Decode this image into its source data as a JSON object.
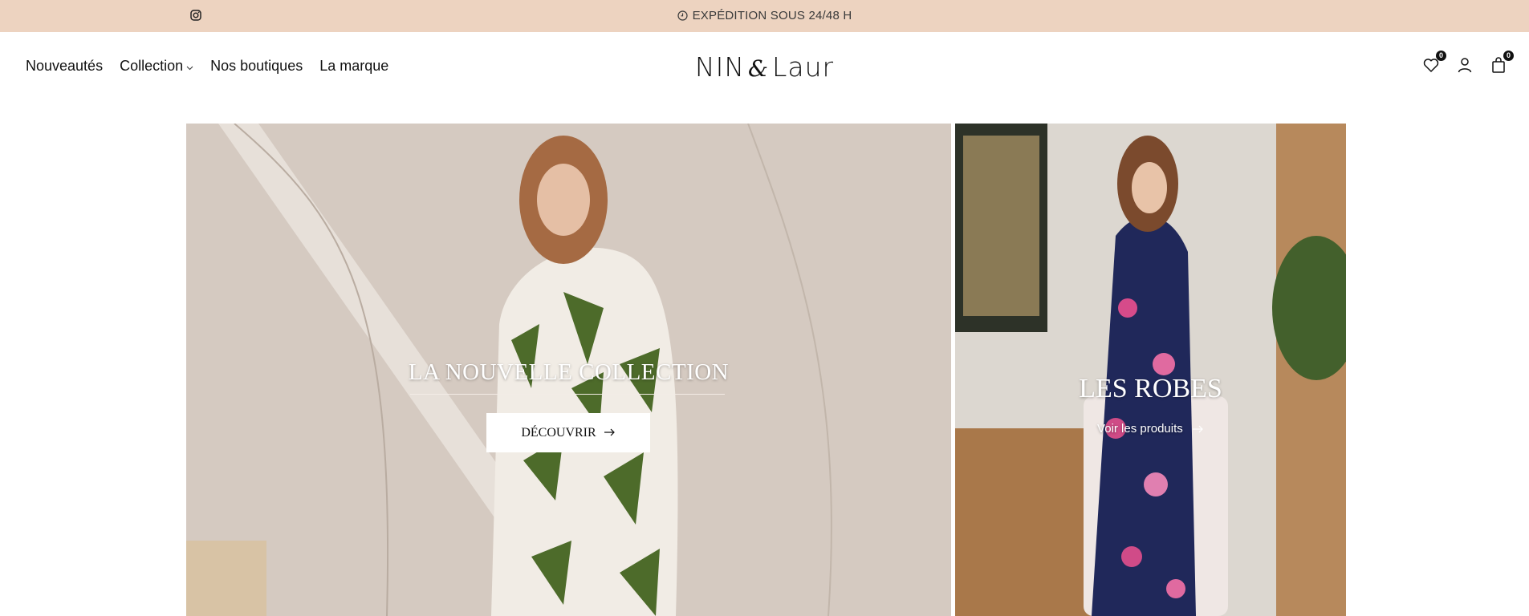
{
  "announcement": {
    "icon": "instagram-icon",
    "shipping_icon": "clock-icon",
    "message": "EXPÉDITION SOUS 24/48 H"
  },
  "nav": {
    "items": [
      {
        "label": "Nouveautés"
      },
      {
        "label": "Collection",
        "has_dropdown": true
      },
      {
        "label": "Nos boutiques"
      },
      {
        "label": "La marque"
      }
    ]
  },
  "logo": {
    "part1": "NIN",
    "amp": "&",
    "part2": "Laur"
  },
  "header_icons": {
    "wishlist_count": "0",
    "cart_count": "0"
  },
  "hero_left": {
    "title": "LA NOUVELLE COLLECTION",
    "button": "DÉCOUVRIR"
  },
  "hero_right": {
    "title": "LES ROBES",
    "link": "Voir les produits"
  }
}
